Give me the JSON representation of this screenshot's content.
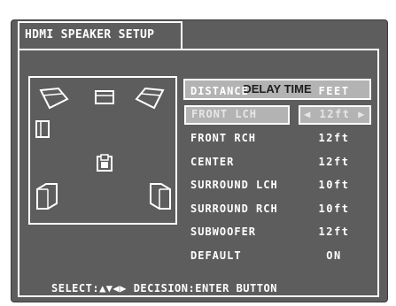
{
  "menu": {
    "title": "HDMI SPEAKER SETUP"
  },
  "panel": {
    "header": "DELAY TIME"
  },
  "settings": [
    {
      "label": "DISTANCE",
      "value": "FEET"
    },
    {
      "label": "FRONT LCH",
      "value": "◀ 12ft ▶",
      "selected": true
    },
    {
      "label": "FRONT RCH",
      "value": "12ft"
    },
    {
      "label": "CENTER",
      "value": "12ft"
    },
    {
      "label": "SURROUND LCH",
      "value": "10ft"
    },
    {
      "label": "SURROUND RCH",
      "value": "10ft"
    },
    {
      "label": "SUBWOOFER",
      "value": "12ft"
    },
    {
      "label": "DEFAULT",
      "value": "ON"
    }
  ],
  "footer": {
    "text": "SELECT:▲▼◀▶ DECISION:ENTER BUTTON"
  },
  "colors": {
    "screen_bg": "#5d5d5d",
    "highlight_bg": "#b3b3b3",
    "text": "#ffffff"
  },
  "speaker_icons": [
    "front-left-speaker-icon",
    "center-speaker-icon",
    "front-right-speaker-icon",
    "subwoofer-icon",
    "listener-icon",
    "surround-left-speaker-icon",
    "surround-right-speaker-icon"
  ]
}
